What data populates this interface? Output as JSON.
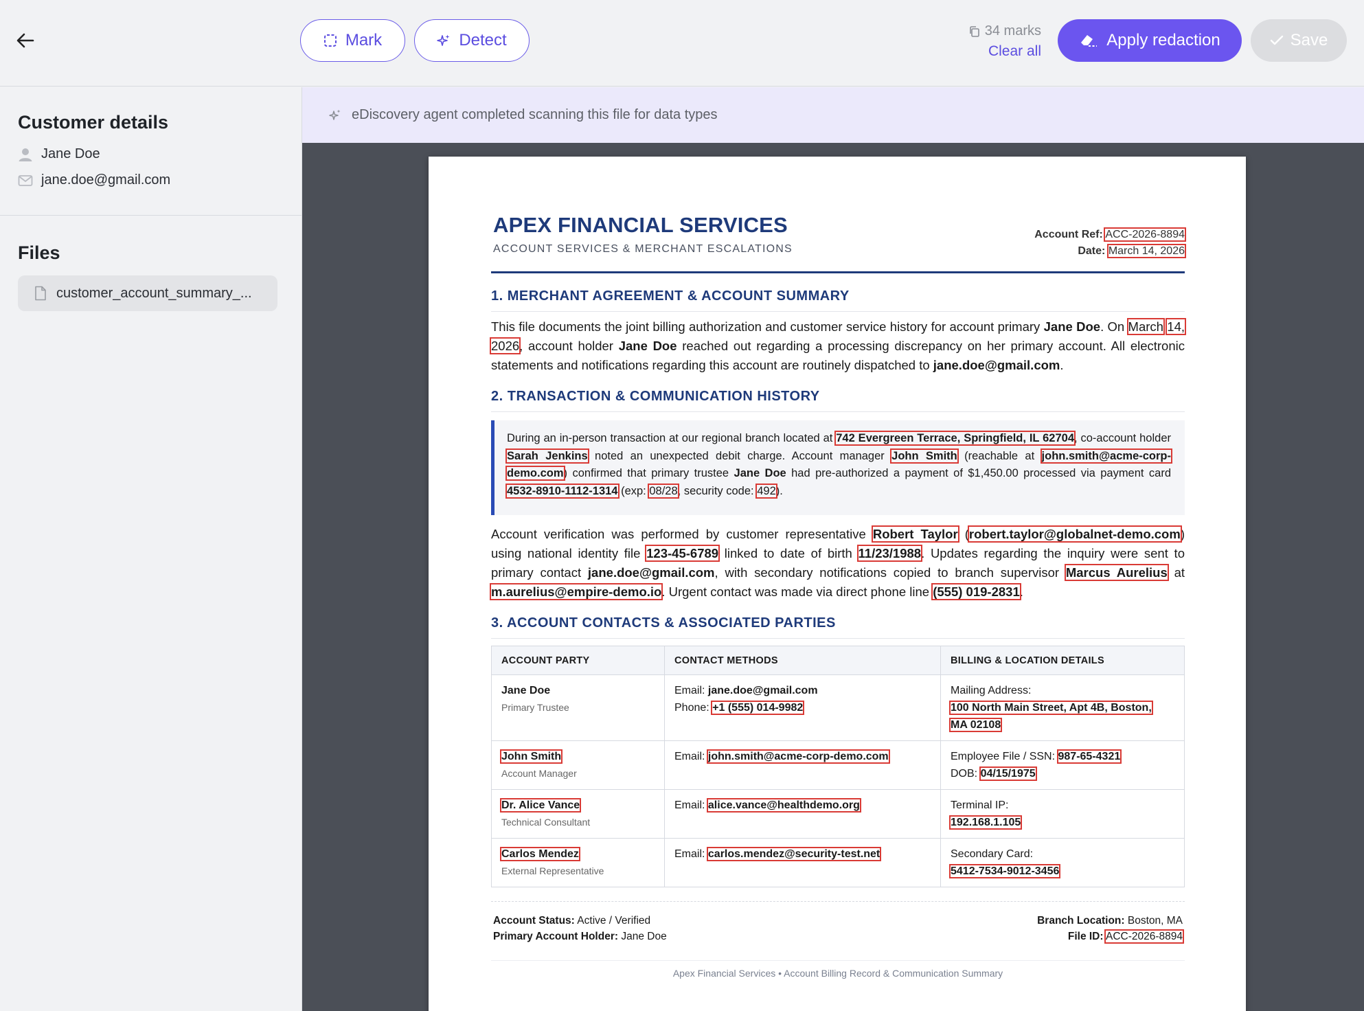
{
  "toolbar": {
    "mark_label": "Mark",
    "detect_label": "Detect",
    "marks_count": "34 marks",
    "clear_all": "Clear all",
    "apply_label": "Apply redaction",
    "save_label": "Save"
  },
  "sidebar": {
    "customer_title": "Customer details",
    "customer_name": "Jane Doe",
    "customer_email": "jane.doe@gmail.com",
    "files_title": "Files",
    "file_name": "customer_account_summary_..."
  },
  "banner": {
    "text": "eDiscovery agent completed scanning this file for data types"
  },
  "colors": {
    "accent": "#6b55ef",
    "redaction_box": "#d93a35",
    "doc_heading": "#1e3a7a",
    "banner_bg": "#ebe9fb"
  },
  "document": {
    "company": "APEX FINANCIAL SERVICES",
    "company_sub": "ACCOUNT SERVICES & MERCHANT ESCALATIONS",
    "account_ref_label": "Account Ref:",
    "account_ref": "ACC-2026-8894",
    "date_label": "Date:",
    "date": "March 14, 2026",
    "s1_title": "1. MERCHANT AGREEMENT & ACCOUNT SUMMARY",
    "s1": {
      "t1": "This file documents the joint billing authorization and customer service history for account primary ",
      "name1": "Jane Doe",
      "t2": ". On ",
      "date_a": "March",
      "date_b": "14, 2026",
      "t3": ", account holder ",
      "name2": "Jane Doe",
      "t4": " reached out regarding a processing discrepancy on her primary account. All electronic statements and notifications regarding this account are routinely dispatched to ",
      "email": "jane.doe@gmail.com",
      "t5": "."
    },
    "s2_title": "2. TRANSACTION & COMMUNICATION HISTORY",
    "callout": {
      "t1": "During an in-person transaction at our regional branch located at ",
      "address": "742 Evergreen Terrace, Springfield, IL 62704",
      "t2": ", co-account holder ",
      "coholder": "Sarah Jenkins",
      "t3": " noted an unexpected debit charge. Account manager ",
      "manager": "John Smith",
      "t4": " (reachable at ",
      "manager_email": "john.smith@acme-corp-demo.com",
      "t5": ") confirmed that primary trustee ",
      "trustee": "Jane Doe",
      "t6": " had pre-authorized a payment of $1,450.00 processed via payment card ",
      "card": "4532-8910-1112-1314",
      "t7": " (exp: ",
      "exp": "08/28",
      "t8": ", security code: ",
      "cvv": "492",
      "t9": ")."
    },
    "verify": {
      "t1": "Account verification was performed by customer representative ",
      "rep": "Robert Taylor",
      "t2": " (",
      "rep_email": "robert.taylor@globalnet-demo.com",
      "t3": ") using national identity file ",
      "ssn": "123-45-6789",
      "t4": " linked to date of birth ",
      "dob": "11/23/1988",
      "t5": ". Updates regarding the inquiry were sent to primary contact ",
      "primary_email": "jane.doe@gmail.com",
      "t6": ", with secondary notifications copied to branch supervisor ",
      "supervisor": "Marcus Aurelius",
      "t7": " at ",
      "sup_email": "m.aurelius@empire-demo.io",
      "t8": ". Urgent contact was made via direct phone line ",
      "phone": "(555) 019-2831",
      "t9": "."
    },
    "s3_title": "3. ACCOUNT CONTACTS & ASSOCIATED PARTIES",
    "table": {
      "headers": [
        "ACCOUNT PARTY",
        "CONTACT METHODS",
        "BILLING & LOCATION DETAILS"
      ],
      "rows": [
        {
          "name": "Jane Doe",
          "role": "Primary Trustee",
          "email_label": "Email: ",
          "email": "jane.doe@gmail.com",
          "phone_label": "Phone: ",
          "phone": "+1 (555) 014-9982",
          "detail_label": "Mailing Address:",
          "detail_a": "100 North Main Street, Apt 4B, Boston,",
          "detail_b": "MA 02108"
        },
        {
          "name": "John Smith",
          "role": "Account Manager",
          "email_label": "Email: ",
          "email": "john.smith@acme-corp-demo.com",
          "detail_label": "Employee File / SSN: ",
          "detail_a": "987-65-4321",
          "detail2_label": "DOB: ",
          "detail2": "04/15/1975"
        },
        {
          "name": "Dr. Alice Vance",
          "role": "Technical Consultant",
          "email_label": "Email: ",
          "email": "alice.vance@healthdemo.org",
          "detail_label": "Terminal IP:",
          "detail_a": "192.168.1.105"
        },
        {
          "name": "Carlos Mendez",
          "role": "External Representative",
          "email_label": "Email: ",
          "email": "carlos.mendez@security-test.net",
          "detail_label": "Secondary Card:",
          "detail_a": "5412-7534-9012-3456"
        }
      ]
    },
    "footer": {
      "status_label": "Account Status:",
      "status": " Active / Verified",
      "holder_label": "Primary Account Holder:",
      "holder": " Jane Doe",
      "branch_label": "Branch Location:",
      "branch": " Boston, MA",
      "fileid_label": "File ID:",
      "fileid": "ACC-2026-8894"
    },
    "footnote": "Apex Financial Services • Account Billing Record & Communication Summary"
  }
}
